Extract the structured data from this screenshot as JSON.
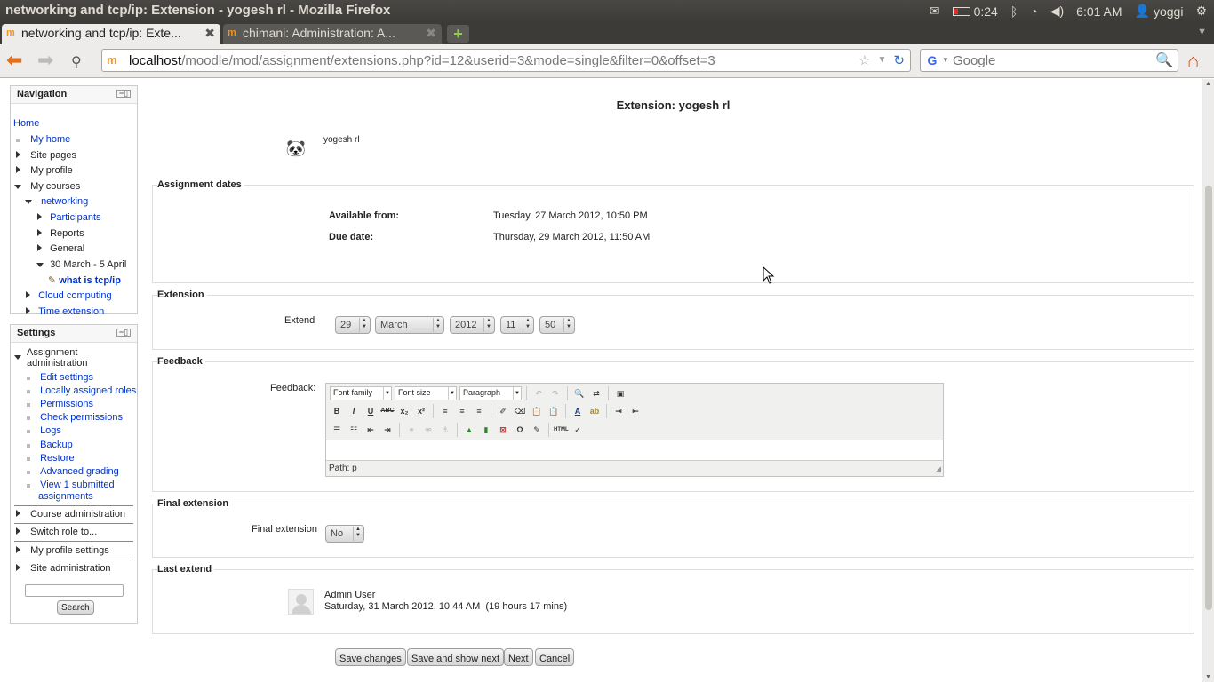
{
  "window": {
    "title": "networking and tcp/ip: Extension - yogesh rl - Mozilla Firefox"
  },
  "tray": {
    "battery_time": "0:24",
    "clock": "6:01 AM",
    "user": "yoggi",
    "icons": [
      "mail-icon",
      "battery-icon",
      "bluetooth-icon",
      "wifi-icon",
      "volume-icon",
      "user-icon",
      "power-icon"
    ]
  },
  "tabs": [
    {
      "label": "networking and tcp/ip: Exte...",
      "active": true
    },
    {
      "label": "chimani: Administration: A...",
      "active": false
    }
  ],
  "urlbar": {
    "host": "localhost",
    "path": "/moodle/mod/assignment/extensions.php?id=12&userid=3&mode=single&filter=0&offset=3"
  },
  "searchbar": {
    "placeholder": "Google"
  },
  "navigation_block": {
    "title": "Navigation",
    "items": {
      "home": "Home",
      "my_home": "My home",
      "site_pages": "Site pages",
      "my_profile": "My profile",
      "my_courses": "My courses",
      "networking": "networking",
      "participants": "Participants",
      "reports": "Reports",
      "general": "General",
      "week": "30 March - 5 April",
      "activity": "what is tcp/ip",
      "cloud": "Cloud computing",
      "time_ext": "Time extension"
    }
  },
  "settings_block": {
    "title": "Settings",
    "assign_admin_1": "Assignment",
    "assign_admin_2": "administration",
    "links": {
      "edit_settings": "Edit settings",
      "local_roles": "Locally assigned roles",
      "permissions": "Permissions",
      "check_permissions": "Check permissions",
      "logs": "Logs",
      "backup": "Backup",
      "restore": "Restore",
      "advanced_grading": "Advanced grading",
      "view_sub_1": "View 1 submitted",
      "view_sub_2": "assignments"
    },
    "course_admin": "Course administration",
    "switch_role": "Switch role to...",
    "profile_settings": "My profile settings",
    "site_admin": "Site administration",
    "search_button": "Search"
  },
  "main": {
    "page_title": "Extension: yogesh rl",
    "user_name": "yogesh rl",
    "dates": {
      "legend": "Assignment dates",
      "available_label": "Available from:",
      "available_value": "Tuesday, 27 March 2012, 10:50 PM",
      "due_label": "Due date:",
      "due_value": "Thursday, 29 March 2012, 11:50 AM"
    },
    "extension": {
      "legend": "Extension",
      "extend_label": "Extend",
      "day": "29",
      "month": "March",
      "year": "2012",
      "hour": "11",
      "minute": "50"
    },
    "feedback": {
      "legend": "Feedback",
      "label": "Feedback:",
      "font_family": "Font family",
      "font_size": "Font size",
      "format": "Paragraph",
      "path": "Path: p"
    },
    "final": {
      "legend": "Final extension",
      "label": "Final extension",
      "value": "No"
    },
    "last_extend": {
      "legend": "Last extend",
      "user": "Admin User",
      "time": "Saturday, 31 March 2012, 10:44 AM  (19 hours 17 mins)"
    },
    "buttons": {
      "save": "Save changes",
      "save_next": "Save and show next",
      "next": "Next",
      "cancel": "Cancel"
    }
  }
}
